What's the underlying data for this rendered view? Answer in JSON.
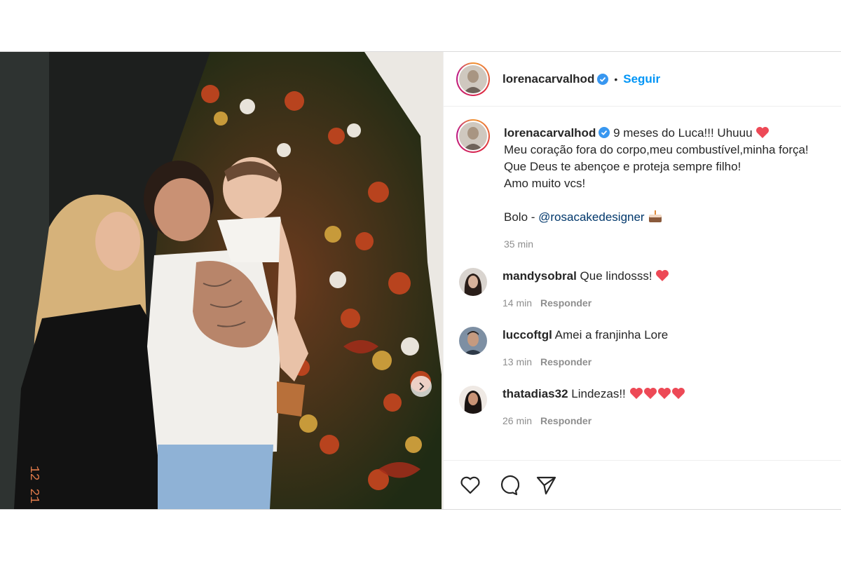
{
  "author": {
    "username": "lorenacarvalhod",
    "follow_label": "Seguir",
    "separator": "•"
  },
  "caption": {
    "username": "lorenacarvalhod",
    "line1": "9 meses do Luca!!! Uhuuu",
    "line2": "Meu coração fora do corpo,meu combustível,minha força!",
    "line3": "Que Deus te abençoe e proteja sempre filho!",
    "line4": "Amo muito vcs!",
    "line6_prefix": "Bolo - ",
    "line6_mention": "@rosacakedesigner",
    "time": "35 min"
  },
  "comments": [
    {
      "username": "mandysobral",
      "text": "Que lindosss!",
      "hearts": 1,
      "time": "14 min",
      "reply_label": "Responder"
    },
    {
      "username": "luccoftgl",
      "text": "Amei a franjinha Lore",
      "hearts": 0,
      "time": "13 min",
      "reply_label": "Responder"
    },
    {
      "username": "thatadias32",
      "text": "Lindezas!!",
      "hearts": 4,
      "time": "26 min",
      "reply_label": "Responder"
    }
  ],
  "photo": {
    "date_stamp": "12 21"
  },
  "colors": {
    "follow": "#0095f6",
    "heart": "#ed4956",
    "verified": "#3897f0",
    "mention": "#00376b"
  },
  "icons": {
    "like": "heart-outline-icon",
    "comment": "comment-bubble-icon",
    "share": "paper-plane-icon",
    "next": "chevron-right-icon"
  }
}
